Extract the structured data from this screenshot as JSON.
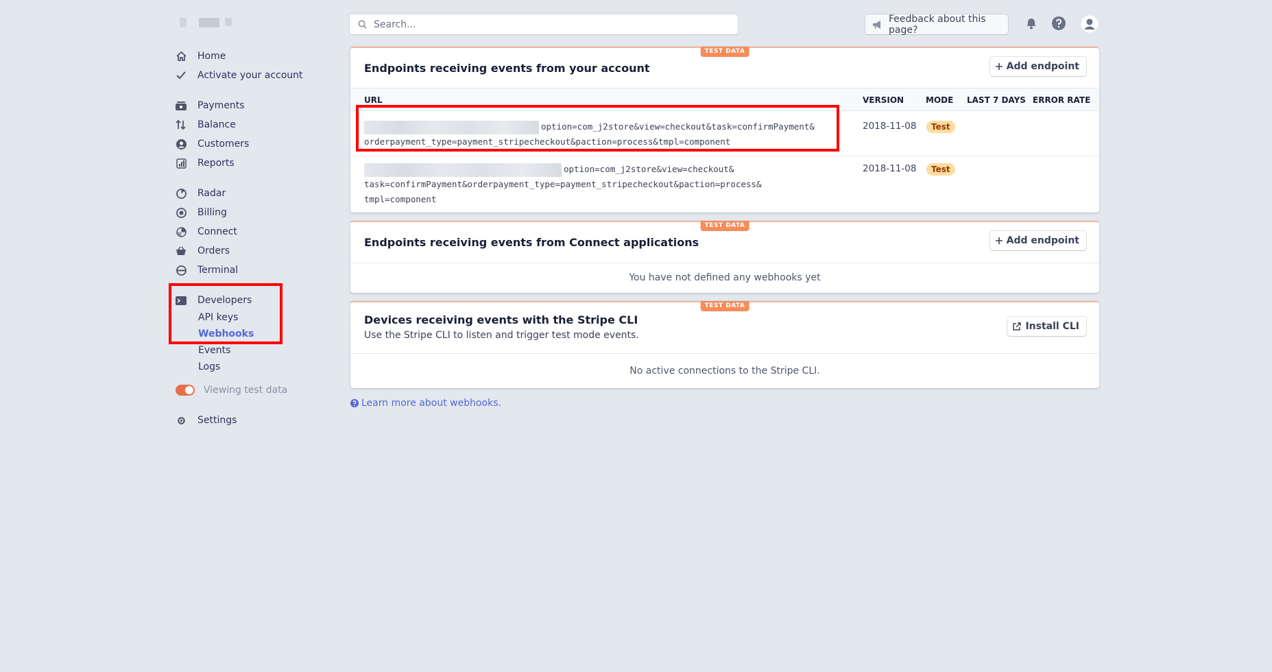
{
  "search": {
    "placeholder": "Search..."
  },
  "topbar": {
    "feedback_label": "Feedback about this page?"
  },
  "sidebar": {
    "home": "Home",
    "activate": "Activate your account",
    "payments": "Payments",
    "balance": "Balance",
    "customers": "Customers",
    "reports": "Reports",
    "radar": "Radar",
    "billing": "Billing",
    "connect": "Connect",
    "orders": "Orders",
    "terminal": "Terminal",
    "developers": "Developers",
    "api_keys": "API keys",
    "webhooks": "Webhooks",
    "events": "Events",
    "logs": "Logs",
    "viewing_test_data": "Viewing test data",
    "settings": "Settings"
  },
  "account_endpoints": {
    "badge": "TEST DATA",
    "title": "Endpoints receiving events from your account",
    "add_button": "Add endpoint",
    "columns": {
      "url": "URL",
      "version": "VERSION",
      "mode": "MODE",
      "last7": "LAST 7 DAYS",
      "error_rate": "ERROR RATE"
    },
    "rows": [
      {
        "url_line1": "option=com_j2store&view=checkout&task=confirmPayment&",
        "url_line2": "orderpayment_type=payment_stripecheckout&paction=process&tmpl=component",
        "version": "2018-11-08",
        "mode": "Test"
      },
      {
        "url_line1": "option=com_j2store&view=checkout&",
        "url_line2": "task=confirmPayment&orderpayment_type=payment_stripecheckout&paction=process&",
        "url_line3": "tmpl=component",
        "version": "2018-11-08",
        "mode": "Test"
      }
    ]
  },
  "connect_endpoints": {
    "badge": "TEST DATA",
    "title": "Endpoints receiving events from Connect applications",
    "add_button": "Add endpoint",
    "empty": "You have not defined any webhooks yet"
  },
  "cli_devices": {
    "badge": "TEST DATA",
    "title": "Devices receiving events with the Stripe CLI",
    "subtitle": "Use the Stripe CLI to listen and trigger test mode events.",
    "install_button": "Install CLI",
    "empty": "No active connections to the Stripe CLI."
  },
  "learn_more": "Learn more about webhooks.",
  "colors": {
    "accent": "#5469d4",
    "test_orange": "#f58c5a",
    "highlight_red": "#ff0000"
  }
}
